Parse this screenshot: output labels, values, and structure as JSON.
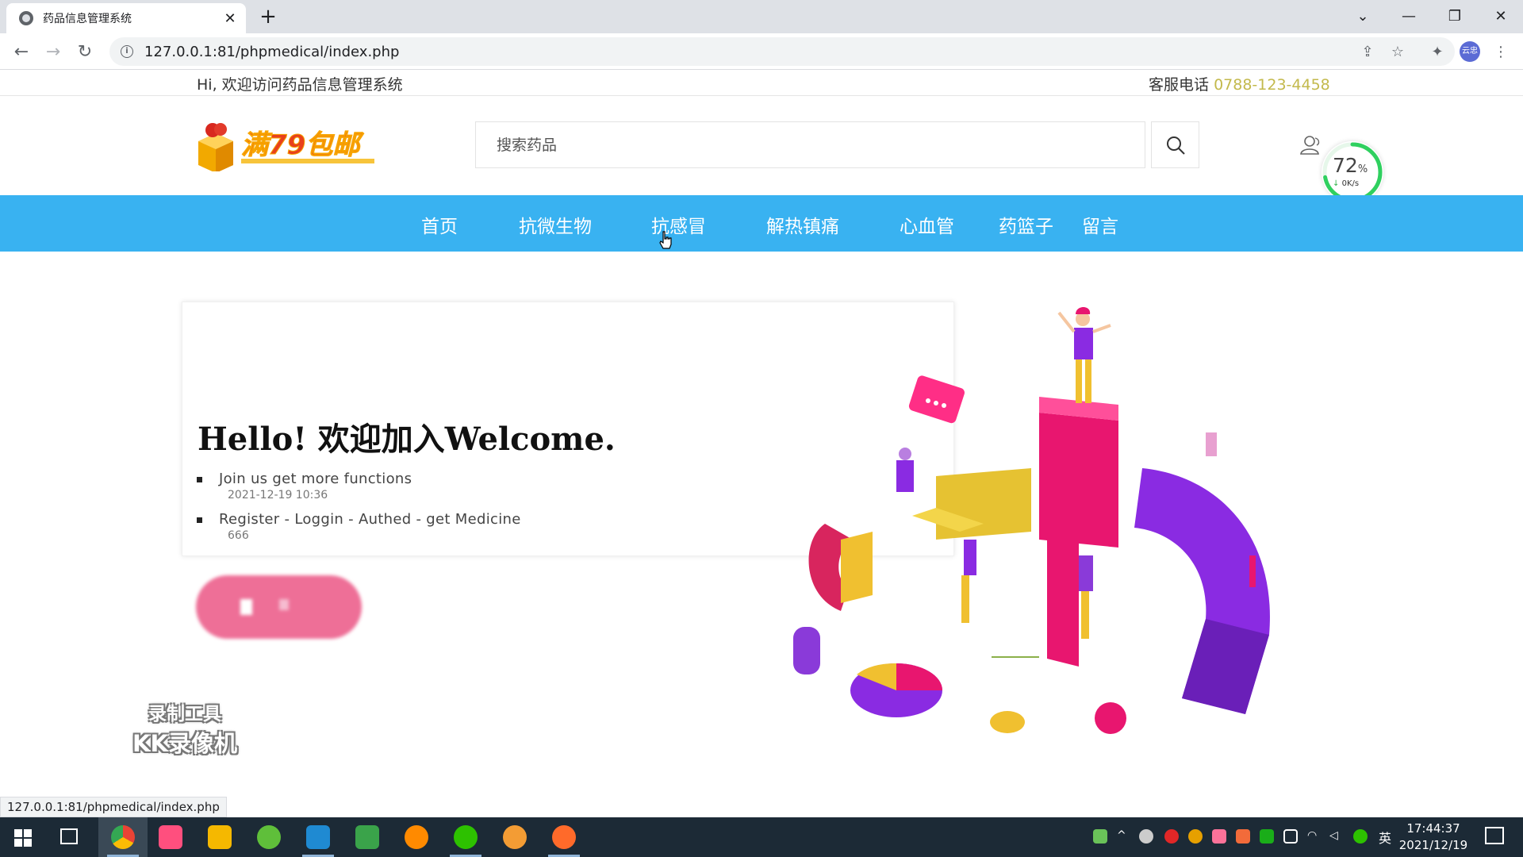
{
  "browser": {
    "tab_title": "药品信息管理系统",
    "tab_close": "✕",
    "new_tab": "+",
    "url": "127.0.0.1:81/phpmedical/index.php",
    "profile_label": "云忠",
    "status_url": "127.0.0.1:81/phpmedical/index.php"
  },
  "topbar": {
    "greeting": "Hi, 欢迎访问药品信息管理系统",
    "hotline_label": "客服电话",
    "hotline_number": "0788-123-4458"
  },
  "header": {
    "logo_text": "满79包邮",
    "search_placeholder": "搜索药品"
  },
  "speed_widget": {
    "percent": "72",
    "percent_unit": "%",
    "rate": "0K/s"
  },
  "nav": {
    "items": [
      {
        "label": "首页"
      },
      {
        "label": "抗微生物"
      },
      {
        "label": "抗感冒"
      },
      {
        "label": "解热镇痛"
      },
      {
        "label": "心血管"
      },
      {
        "label": "药篮子"
      },
      {
        "label": "留言"
      }
    ]
  },
  "hero": {
    "title": "Hello! 欢迎加入Welcome.",
    "items": [
      {
        "text": "Join us  get more functions",
        "sub": "2021-12-19 10:36"
      },
      {
        "text": "Register - Loggin - Authed - get Medicine",
        "sub": "666"
      }
    ]
  },
  "watermark": {
    "line1": "录制工具",
    "line2": "KK录像机"
  },
  "taskbar": {
    "time": "17:44:37",
    "date": "2021/12/19",
    "ime": "英"
  },
  "colors": {
    "nav_bg": "#39b2f1",
    "hotline": "#c3b94c",
    "pill": "#ee6f97"
  }
}
